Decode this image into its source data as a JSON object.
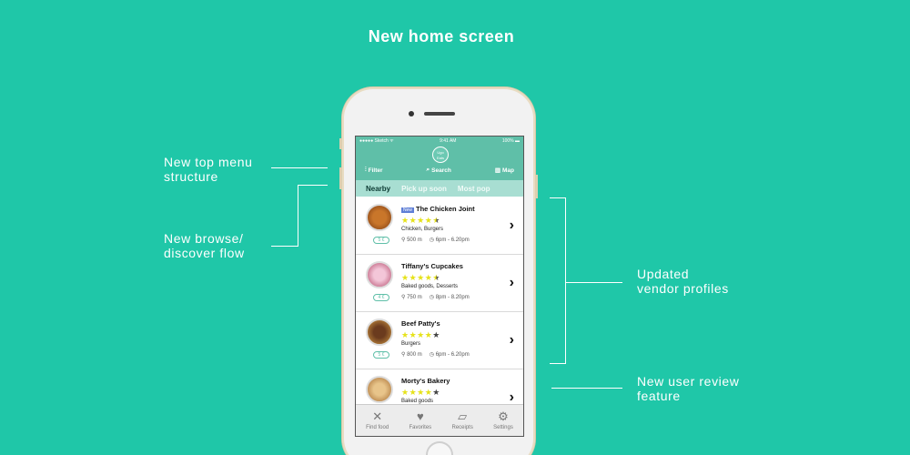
{
  "title": "New home screen",
  "annotations": {
    "top_menu": [
      "New top menu",
      "structure"
    ],
    "browse": [
      "New browse/",
      "discover flow"
    ],
    "vendor": [
      "Updated",
      "vendor profiles"
    ],
    "review": [
      "New user review",
      "feature"
    ]
  },
  "status": {
    "carrier": "●●●●● Sketch ᯤ",
    "time": "9:41 AM",
    "battery": "100% ▬"
  },
  "logo_text": "Ugo Eats",
  "menu": {
    "filter": "Filter",
    "search": "Search",
    "map": "Map"
  },
  "tabs": [
    "Nearby",
    "Pick up soon",
    "Most pop"
  ],
  "items": [
    {
      "badge": "New",
      "name": "The Chicken Joint",
      "rating": 4.5,
      "stars": "★★★★",
      "half": "★",
      "cats": "Chicken, Burgers",
      "dist": "500 m",
      "hours": "6pm - 6.20pm",
      "price": "5 €"
    },
    {
      "badge": "",
      "name": "Tiffany's Cupcakes",
      "rating": 4.5,
      "stars": "★★★★",
      "half": "★",
      "cats": "Baked goods, Desserts",
      "dist": "750 m",
      "hours": "8pm - 8.20pm",
      "price": "4 €"
    },
    {
      "badge": "",
      "name": "Beef Patty's",
      "rating": 4,
      "stars": "★★★★",
      "half": "★",
      "cats": "Burgers",
      "dist": "800 m",
      "hours": "6pm - 6.20pm",
      "price": "5 €"
    },
    {
      "badge": "",
      "name": "Morty's Bakery",
      "rating": 4,
      "stars": "★★★★",
      "half": "★",
      "cats": "Baked goods",
      "dist": "",
      "hours": "",
      "price": ""
    }
  ],
  "tabbar": [
    {
      "label": "Find food",
      "icon": "fork-knife-icon"
    },
    {
      "label": "Favorites",
      "icon": "heart-icon"
    },
    {
      "label": "Receipts",
      "icon": "ticket-icon"
    },
    {
      "label": "Settings",
      "icon": "gear-icon"
    }
  ],
  "colors": {
    "background": "#1fc7a8",
    "app_header": "#5fbfa8",
    "tabs_bg": "#a8ded2",
    "star": "#e6e21a"
  }
}
